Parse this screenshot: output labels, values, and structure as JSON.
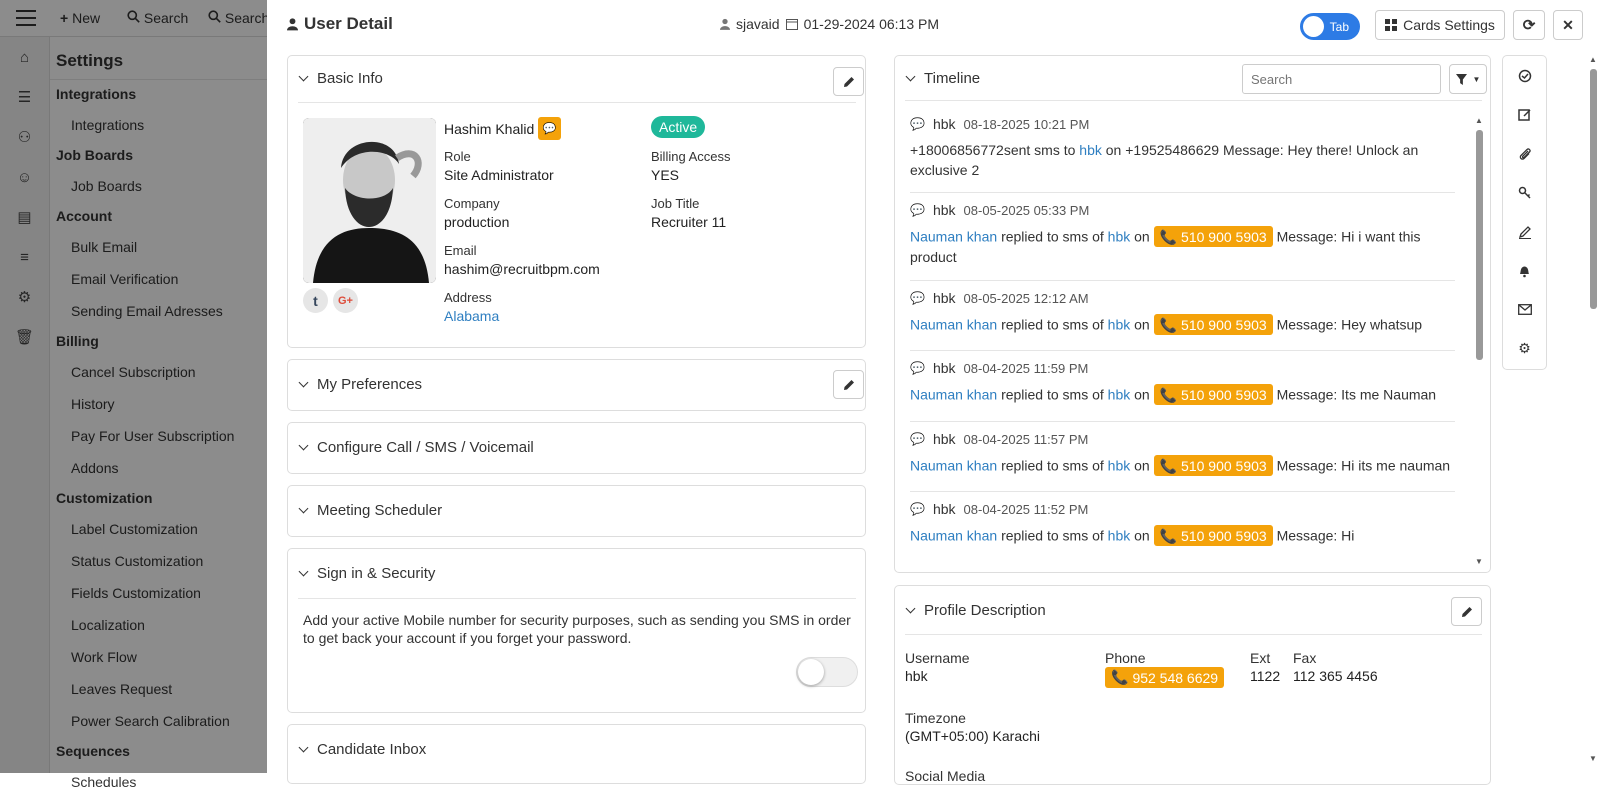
{
  "app": {
    "topbar": {
      "new_label": "New",
      "search_label": "Search",
      "search2_label": "Search"
    },
    "settings": {
      "title": "Settings",
      "groups": [
        {
          "label": "Integrations",
          "items": [
            "Integrations"
          ]
        },
        {
          "label": "Job Boards",
          "items": [
            "Job Boards"
          ]
        },
        {
          "label": "Account",
          "items": [
            "Bulk Email",
            "Email Verification",
            "Sending Email Adresses"
          ]
        },
        {
          "label": "Billing",
          "items": [
            "Cancel Subscription",
            "History",
            "Pay For User Subscription",
            "Addons"
          ]
        },
        {
          "label": "Customization",
          "items": [
            "Label Customization",
            "Status Customization",
            "Fields Customization",
            "Localization",
            "Work Flow",
            "Leaves Request",
            "Power Search Calibration"
          ]
        },
        {
          "label": "Sequences",
          "items": [
            "Schedules"
          ]
        }
      ]
    }
  },
  "modal": {
    "title": "User Detail",
    "owner": "sjavaid",
    "date": "01-29-2024 06:13 PM",
    "tab_toggle_label": "Tab",
    "cards_settings_label": "Cards Settings"
  },
  "basic_info": {
    "header": "Basic Info",
    "name": "Hashim Khalid",
    "status": "Active",
    "role_label": "Role",
    "role": "Site Administrator",
    "billing_label": "Billing Access",
    "billing": "YES",
    "company_label": "Company",
    "company": "production",
    "job_title_label": "Job Title",
    "job_title": "Recruiter 11",
    "email_label": "Email",
    "email": "hashim@recruitbpm.com",
    "address_label": "Address",
    "address": "Alabama"
  },
  "sections": {
    "preferences": "My Preferences",
    "call_sms": "Configure Call / SMS / Voicemail",
    "meeting": "Meeting Scheduler",
    "security": "Sign in & Security",
    "security_text": "Add your active Mobile number for security purposes, such as sending you SMS in order to get back your account if you forget your password.",
    "inbox": "Candidate Inbox"
  },
  "timeline": {
    "header": "Timeline",
    "search_placeholder": "Search",
    "entries": [
      {
        "user": "hbk",
        "date": "08-18-2025 10:21 PM",
        "pre": "+18006856772sent sms to",
        "who": "hbk",
        "mid": "on +19525486629 Message: Hey there! Unlock an exclusive 2"
      },
      {
        "user": "hbk",
        "date": "08-05-2025 05:33 PM",
        "actor": "Nauman khan",
        "verb": "replied to sms of",
        "who": "hbk",
        "on": "on",
        "phone": "510 900 5903",
        "msg": "Message: Hi i want this product"
      },
      {
        "user": "hbk",
        "date": "08-05-2025 12:12 AM",
        "actor": "Nauman khan",
        "verb": "replied to sms of",
        "who": "hbk",
        "on": "on",
        "phone": "510 900 5903",
        "msg": "Message: Hey whatsup"
      },
      {
        "user": "hbk",
        "date": "08-04-2025 11:59 PM",
        "actor": "Nauman khan",
        "verb": "replied to sms of",
        "who": "hbk",
        "on": "on",
        "phone": "510 900 5903",
        "msg": "Message: Its me Nauman"
      },
      {
        "user": "hbk",
        "date": "08-04-2025 11:57 PM",
        "actor": "Nauman khan",
        "verb": "replied to sms of",
        "who": "hbk",
        "on": "on",
        "phone": "510 900 5903",
        "msg": "Message: Hi its me nauman"
      },
      {
        "user": "hbk",
        "date": "08-04-2025 11:52 PM",
        "actor": "Nauman khan",
        "verb": "replied to sms of",
        "who": "hbk",
        "on": "on",
        "phone": "510 900 5903",
        "msg": "Message: Hi"
      }
    ]
  },
  "profile": {
    "header": "Profile Description",
    "username_label": "Username",
    "username": "hbk",
    "phone_label": "Phone",
    "phone": "952 548 6629",
    "ext_label": "Ext",
    "ext": "1122",
    "fax_label": "Fax",
    "fax": "112 365 4456",
    "timezone_label": "Timezone",
    "timezone": "(GMT+05:00) Karachi",
    "social_label": "Social Media"
  },
  "colors": {
    "accent": "#2d7be5",
    "badge": "#f4a20a",
    "active": "#1fb89a",
    "link": "#2f7fc1"
  }
}
